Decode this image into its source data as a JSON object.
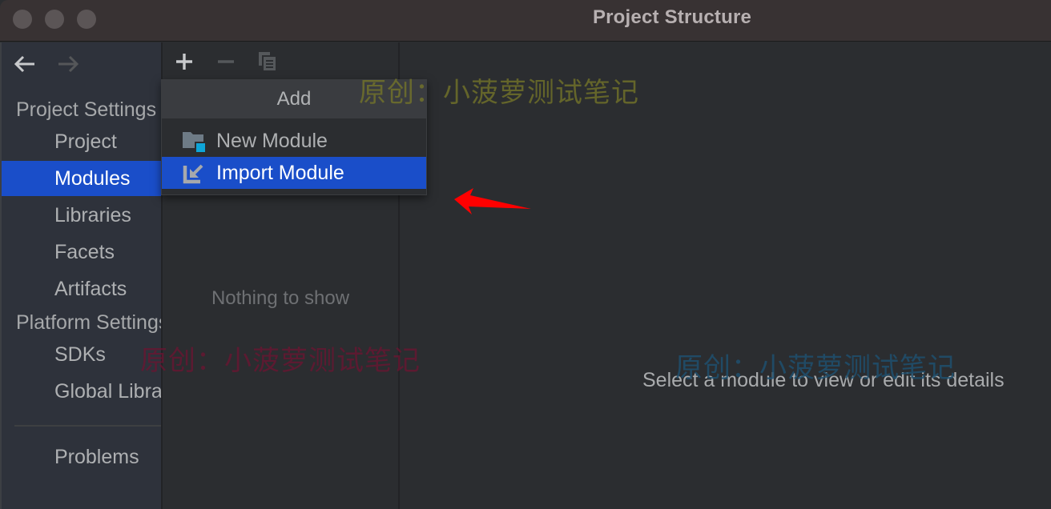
{
  "window": {
    "title": "Project Structure",
    "traffic_lights": [
      "close",
      "minimize",
      "zoom"
    ]
  },
  "navigation": {
    "back_icon": "arrow-left-icon",
    "forward_icon": "arrow-right-icon"
  },
  "sidebar": {
    "sections": [
      {
        "label": "Project Settings",
        "type": "header"
      },
      {
        "label": "Project",
        "type": "item"
      },
      {
        "label": "Modules",
        "type": "item",
        "selected": true
      },
      {
        "label": "Libraries",
        "type": "item"
      },
      {
        "label": "Facets",
        "type": "item"
      },
      {
        "label": "Artifacts",
        "type": "item"
      },
      {
        "label": "Platform Settings",
        "type": "header"
      },
      {
        "label": "SDKs",
        "type": "item"
      },
      {
        "label": "Global Libraries",
        "type": "item"
      },
      {
        "label": "Problems",
        "type": "item"
      }
    ]
  },
  "module_list": {
    "toolbar": {
      "add_icon": "plus-icon",
      "remove_icon": "minus-icon",
      "copy_icon": "copy-icon"
    },
    "empty_text": "Nothing to show"
  },
  "add_popup": {
    "title": "Add",
    "items": [
      {
        "label": "New Module",
        "icon": "folder-module-icon"
      },
      {
        "label": "Import Module",
        "icon": "import-arrow-icon",
        "selected": true
      }
    ]
  },
  "detail": {
    "empty_text": "Select a module to view or edit its details"
  },
  "watermarks": [
    "原创：小菠萝测试笔记",
    "原创：小菠萝测试笔记",
    "原创：小菠萝测试笔记"
  ],
  "colors": {
    "selection": "#1a4ec9",
    "annotation_arrow": "#ff0000",
    "titlebar": "#383233",
    "sidebar_bg": "#2e323b",
    "panel_bg": "#2b2d30"
  }
}
